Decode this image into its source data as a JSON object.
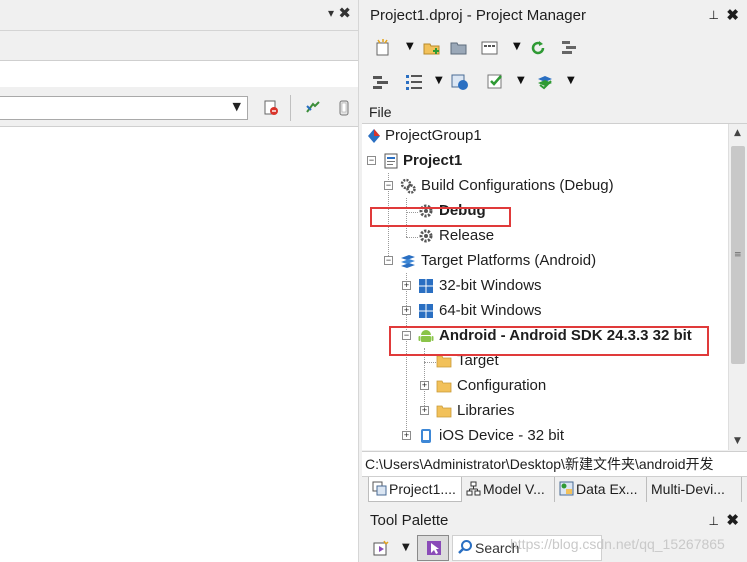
{
  "left_pane": {
    "pin_glyph": "▾",
    "close_glyph": "✖",
    "combo_arrow": "▼"
  },
  "project_manager": {
    "title": "Project1.dproj - Project Manager",
    "pin_glyph": "⊥",
    "close_glyph": "✖",
    "toolbar_row1": [
      "add-new-icon",
      "add-folder-icon",
      "open-folder-icon",
      "build-configs-icon",
      "sync-icon",
      "options-icon"
    ],
    "toolbar_row2": [
      "list-icon",
      "tree-view-icon",
      "build-icon",
      "check-icon",
      "layers-icon"
    ],
    "dropdown_glyph": "▼",
    "file_header": "File",
    "tree": {
      "project_group": "ProjectGroup1",
      "project": "Project1",
      "build_configurations": "Build Configurations (Debug)",
      "debug": "Debug",
      "release": "Release",
      "target_platforms": "Target Platforms (Android)",
      "win32": "32-bit Windows",
      "win64": "64-bit Windows",
      "android": "Android - Android SDK 24.3.3 32 bit",
      "target": "Target",
      "configuration": "Configuration",
      "libraries": "Libraries",
      "ios_device": "iOS Device - 32 bit"
    },
    "path": "C:\\Users\\Administrator\\Desktop\\新建文件夹\\android开发",
    "tabs": [
      "Project1....",
      "Model V...",
      "Data Ex...",
      "Multi-Devi..."
    ],
    "expander_minus": "−",
    "expander_plus": "+"
  },
  "tool_palette": {
    "title": "Tool Palette",
    "pin_glyph": "⊥",
    "close_glyph": "✖",
    "search_label": "Search",
    "dropdown_glyph": "▼"
  },
  "watermark": "https://blog.csdn.net/qq_15267865",
  "colors": {
    "highlight": "#e03a3a",
    "panel_bg": "#f0f0f0",
    "windows_blue": "#2a6fc2",
    "android_green": "#8ac449",
    "folder_yellow": "#f2c15a"
  }
}
